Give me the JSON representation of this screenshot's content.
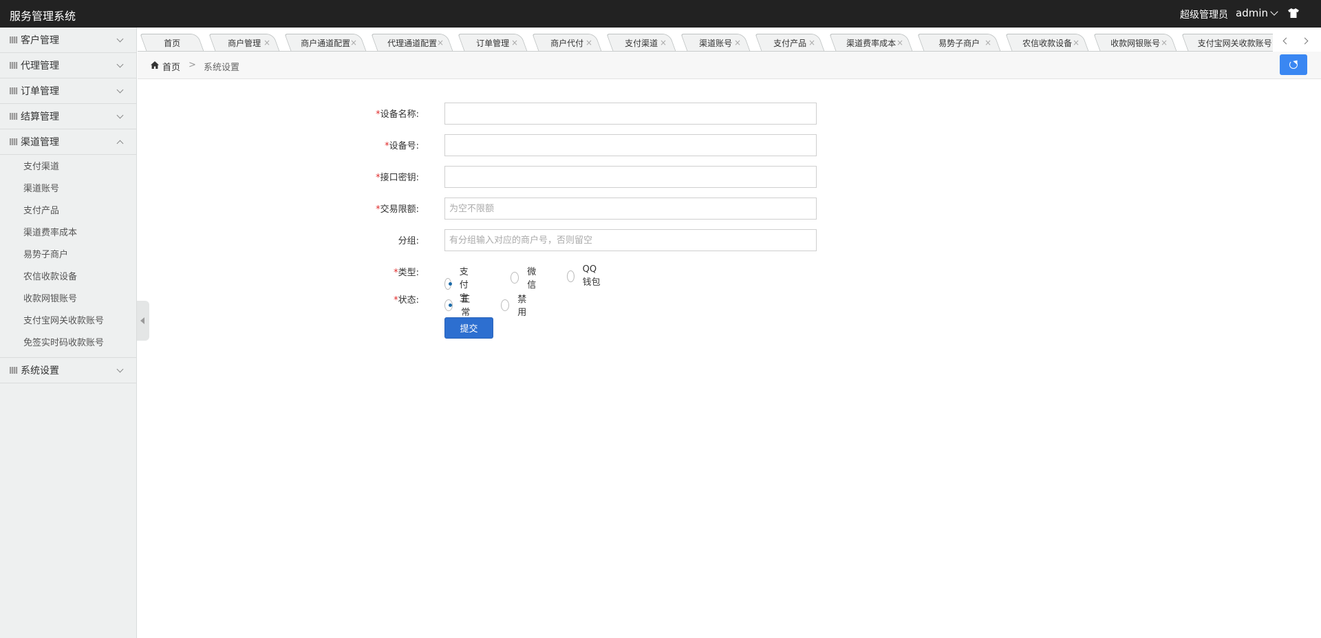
{
  "header": {
    "title": "服务管理系统",
    "role": "超级管理员",
    "username": "admin",
    "skin_icon": "tshirt-icon"
  },
  "sidebar": {
    "groups_top": [
      {
        "label": "客户管理",
        "expanded": false
      },
      {
        "label": "代理管理",
        "expanded": false
      },
      {
        "label": "订单管理",
        "expanded": false
      },
      {
        "label": "结算管理",
        "expanded": false
      },
      {
        "label": "渠道管理",
        "expanded": true
      }
    ],
    "channel_items": [
      {
        "label": "支付渠道"
      },
      {
        "label": "渠道账号"
      },
      {
        "label": "支付产品"
      },
      {
        "label": "渠道费率成本"
      },
      {
        "label": "易势子商户"
      },
      {
        "label": "农信收款设备"
      },
      {
        "label": "收款网银账号"
      },
      {
        "label": "支付宝网关收款账号"
      },
      {
        "label": "免签实时码收款账号"
      }
    ],
    "group_bottom": {
      "label": "系统设置",
      "expanded": false
    }
  },
  "tabs": [
    {
      "label": "首页",
      "closable": false
    },
    {
      "label": "商户管理",
      "closable": true
    },
    {
      "label": "商户通道配置",
      "closable": true
    },
    {
      "label": "代理通道配置",
      "closable": true
    },
    {
      "label": "订单管理",
      "closable": true
    },
    {
      "label": "商户代付",
      "closable": true
    },
    {
      "label": "支付渠道",
      "closable": true
    },
    {
      "label": "渠道账号",
      "closable": true
    },
    {
      "label": "支付产品",
      "closable": true
    },
    {
      "label": "渠道费率成本",
      "closable": true
    },
    {
      "label": "易势子商户",
      "closable": true
    },
    {
      "label": "农信收款设备",
      "closable": true
    },
    {
      "label": "收款网银账号",
      "closable": true
    },
    {
      "label": "支付宝网关收款账号",
      "closable": true
    }
  ],
  "tab_close_glyph": "×",
  "breadcrumb": {
    "home": "首页",
    "separator": ">",
    "current": "系统设置"
  },
  "form": {
    "required_mark": "*",
    "device_name": {
      "label": "设备名称:",
      "value": "",
      "placeholder": ""
    },
    "device_no": {
      "label": "设备号:",
      "value": "",
      "placeholder": ""
    },
    "api_key": {
      "label": "接口密钥:",
      "value": "",
      "placeholder": ""
    },
    "trade_limit": {
      "label": "交易限额:",
      "value": "",
      "placeholder": "为空不限额"
    },
    "group": {
      "label": "分组:",
      "value": "",
      "placeholder": "有分组输入对应的商户号，否则留空"
    },
    "type": {
      "label": "类型:",
      "options": [
        "支付宝",
        "微信",
        "QQ钱包"
      ],
      "selected": "支付宝"
    },
    "status": {
      "label": "状态:",
      "options": [
        "正常",
        "禁用"
      ],
      "selected": "正常"
    },
    "submit_label": "提交"
  },
  "colors": {
    "topbar": "#222222",
    "sidebar": "#eef0f0",
    "accent_button": "#3a87f2",
    "submit_button": "#2d6fd0",
    "required": "#e02b2b"
  }
}
